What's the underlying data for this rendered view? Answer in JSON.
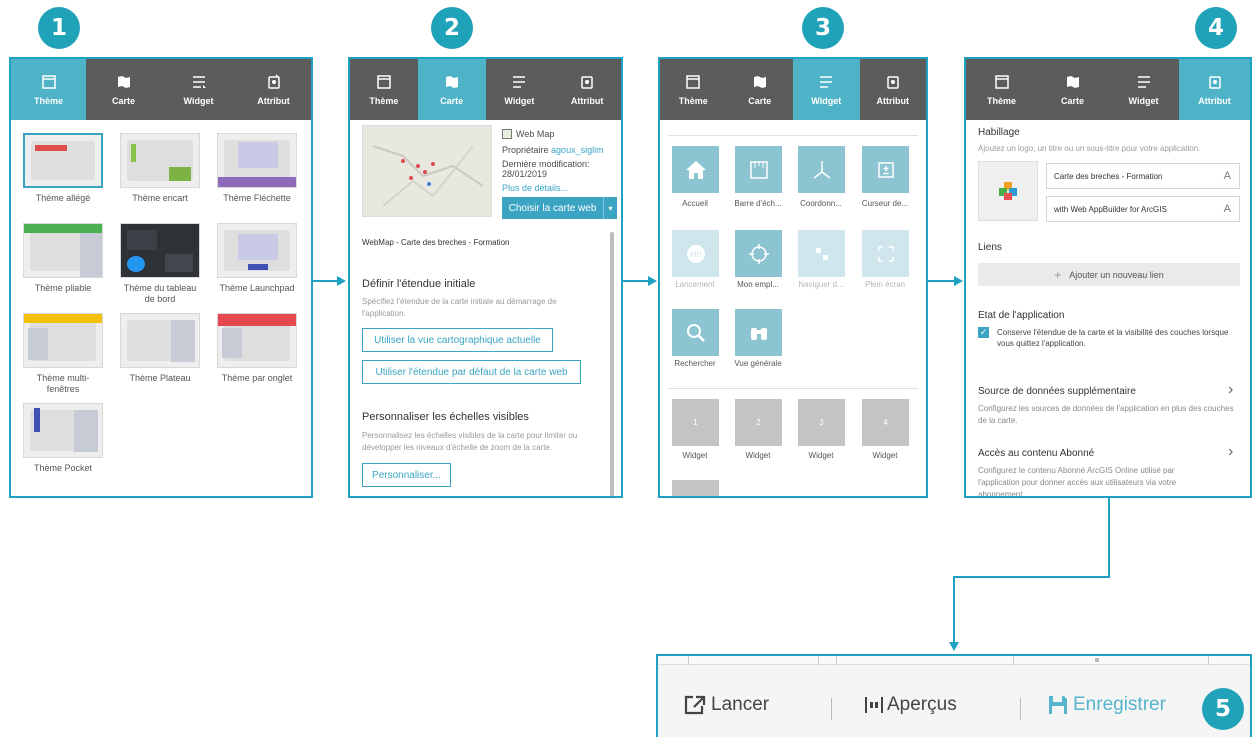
{
  "steps": [
    "1",
    "2",
    "3",
    "4",
    "5"
  ],
  "tabs": [
    "Thème",
    "Carte",
    "Widget",
    "Attribut"
  ],
  "themes": [
    {
      "name": "Thème allégé"
    },
    {
      "name": "Thème encart"
    },
    {
      "name": "Thème Fléchette"
    },
    {
      "name": "Thème pliable"
    },
    {
      "name": "Thème du tableau de bord"
    },
    {
      "name": "Thème Launchpad"
    },
    {
      "name": "Thème multi-fenêtres"
    },
    {
      "name": "Thème Plateau"
    },
    {
      "name": "Thème par onglet"
    },
    {
      "name": "Thème Pocket"
    }
  ],
  "carte": {
    "webmap_label": "Web Map",
    "owner_label": "Propriétaire",
    "owner": "agoux_siglim",
    "modified_label": "Dernière modification:",
    "modified_date": "28/01/2019",
    "details_link": "Plus de détails...",
    "choose_button": "Choisir la carte web",
    "webmap_title": "WebMap - Carte des breches - Formation",
    "extent_heading": "Définir l'étendue initiale",
    "extent_desc": "Spécifiez l'étendue de la carte initiale au démarrage de l'application.",
    "btn_current_view": "Utiliser la vue cartographique actuelle",
    "btn_default_extent": "Utiliser l'étendue par défaut de la carte web",
    "scales_heading": "Personnaliser les échelles visibles",
    "scales_desc": "Personnalisez les échelles visibles de la carte pour limiter ou développer les niveaux d'échelle de zoom de la carte.",
    "btn_customize": "Personnaliser..."
  },
  "widgets": {
    "items": [
      {
        "label": "Accueil",
        "icon": "home-icon"
      },
      {
        "label": "Barre d'éch...",
        "icon": "scalebar-icon"
      },
      {
        "label": "Coordonn...",
        "icon": "coordinate-icon"
      },
      {
        "label": "Curseur de...",
        "icon": "slider-icon"
      },
      {
        "label": "Lancement",
        "icon": "splash-icon"
      },
      {
        "label": "Mon empl...",
        "icon": "locate-icon"
      },
      {
        "label": "Naviguer d...",
        "icon": "navigate-icon"
      },
      {
        "label": "Plein écran",
        "icon": "fullscreen-icon"
      },
      {
        "label": "Rechercher",
        "icon": "search-icon"
      },
      {
        "label": "Vue générale",
        "icon": "overview-icon"
      }
    ],
    "slots": [
      {
        "num": "1",
        "label": "Widget"
      },
      {
        "num": "2",
        "label": "Widget"
      },
      {
        "num": "3",
        "label": "Widget"
      },
      {
        "num": "4",
        "label": "Widget"
      }
    ]
  },
  "attribut": {
    "habillage_title": "Habillage",
    "habillage_desc": "Ajoutez un logo, un titre ou un sous-titre pour votre application.",
    "title_value": "Carte des breches - Formation",
    "subtitle_value": "with Web AppBuilder for ArcGIS",
    "font_icon_glyph": "A",
    "liens_title": "Liens",
    "add_link": "Ajouter un nouveau lien",
    "state_title": "Etat de l'application",
    "state_checkbox": "Conserve l'étendue de la carte et la visibilité des couches lorsque vous quittez l'application.",
    "source_title": "Source de données supplémentaire",
    "source_desc": "Configurez les sources de données de l'application en plus des couches de la carte.",
    "access_title": "Accès au contenu Abonné",
    "access_desc": "Configurez le contenu Abonné ArcGIS Online utilisé par l'application pour donner accès aux utilisateurs via votre abonnement."
  },
  "toolbar": {
    "launch": "Lancer",
    "previews": "Aperçus",
    "save": "Enregistrer"
  },
  "colors": {
    "accent": "#1fa1c3",
    "tab_active": "#4fb3c8",
    "tab_bar": "#5c5c5c",
    "tile": "#8cc4d1",
    "badge": "#20a3b9"
  }
}
